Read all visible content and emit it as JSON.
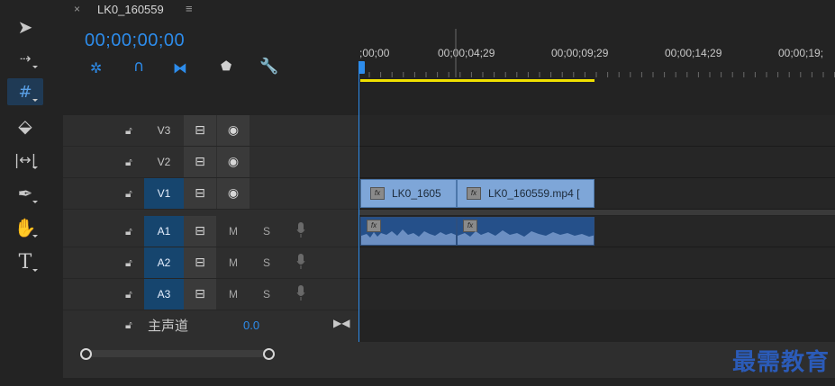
{
  "tab": {
    "close": "×",
    "title": "LK0_160559",
    "menu": "≡"
  },
  "timecode": "00;00;00;00",
  "controls": [
    "snap-icon",
    "magnet-icon",
    "linked-selection-icon",
    "marker-icon",
    "wrench-icon"
  ],
  "ruler": {
    "labels": [
      ";00;00",
      "00;00;04;29",
      "00;00;09;29",
      "00;00;14;29",
      "00;00;19;"
    ]
  },
  "tools": [
    "selection-arrow-icon",
    "track-select-forward-icon",
    "ripple-edit-icon",
    "razor-icon",
    "slip-icon",
    "pen-icon",
    "hand-icon",
    "type-icon"
  ],
  "video_tracks": [
    {
      "name": "V3",
      "selected": false
    },
    {
      "name": "V2",
      "selected": false
    },
    {
      "name": "V1",
      "selected": true
    }
  ],
  "audio_tracks": [
    {
      "name": "A1",
      "m": "M",
      "s": "S"
    },
    {
      "name": "A2",
      "m": "M",
      "s": "S"
    },
    {
      "name": "A3",
      "m": "M",
      "s": "S"
    }
  ],
  "master": {
    "label": "主声道",
    "value": "0.0"
  },
  "clips": {
    "video": [
      {
        "label": "LK0_1605"
      },
      {
        "label": "LK0_160559.mp4 ["
      }
    ],
    "fx_badge": "fx"
  },
  "watermark": "最需教育",
  "colors": {
    "accent": "#2d8ceb",
    "clip_video": "#7ea6d8",
    "clip_audio": "#25508a",
    "work_area": "#f0e000"
  }
}
